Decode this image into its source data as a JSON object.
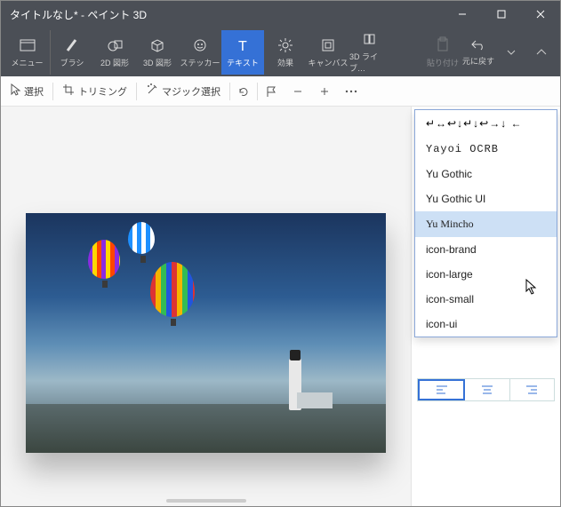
{
  "window": {
    "title": "タイトルなし* - ペイント 3D"
  },
  "ribbon": {
    "menu": "メニュー",
    "brush": "ブラシ",
    "shapes2d": "2D 図形",
    "shapes3d": "3D 図形",
    "sticker": "ステッカー",
    "text": "テキスト",
    "effects": "効果",
    "canvas": "キャンバス",
    "lib3d": "3D ライブ…",
    "paste": "貼り付け",
    "undo": "元に戻す"
  },
  "toolbar": {
    "select": "選択",
    "trimming": "トリミング",
    "magic": "マジック選択"
  },
  "fonts": {
    "symbols": "↵↔↩↓↵↓↩→↓   ←",
    "items": [
      "Yayoi OCRB",
      "Yu Gothic",
      "Yu Gothic UI",
      "Yu Mincho",
      "icon-brand",
      "icon-large",
      "icon-small",
      "icon-ui"
    ],
    "selected_index": 3
  }
}
